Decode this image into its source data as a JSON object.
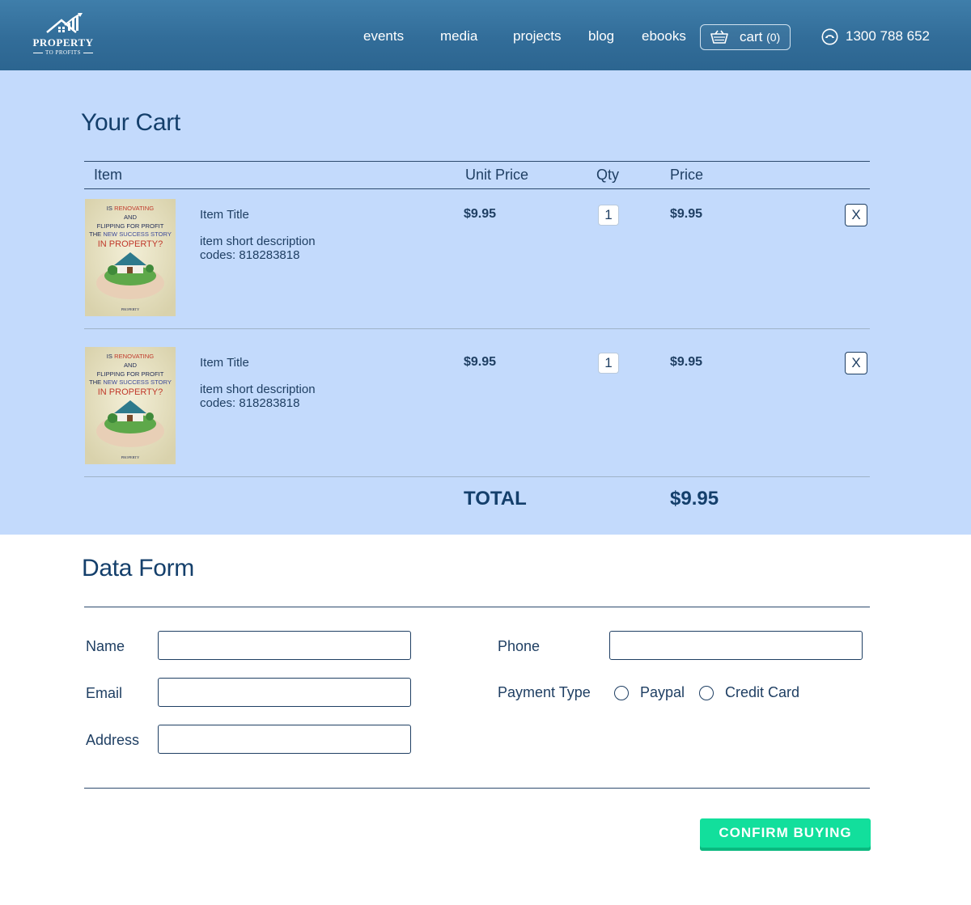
{
  "brand": {
    "name": "PROPERTY",
    "tagline": "TO PROFITS"
  },
  "nav": [
    {
      "label": "events"
    },
    {
      "label": "media"
    },
    {
      "label": "projects"
    },
    {
      "label": "blog"
    },
    {
      "label": "ebooks"
    }
  ],
  "cart_button": {
    "label": "cart",
    "count": "(0)"
  },
  "phone": {
    "number": "1300 788 652"
  },
  "cart": {
    "title": "Your Cart",
    "columns": {
      "item": "Item",
      "unit_price": "Unit Price",
      "qty": "Qty",
      "price": "Price"
    },
    "items": [
      {
        "cover_lines": [
          "IS ",
          "RENOVATING",
          "AND",
          "FLIPPING FOR PROFIT",
          "THE ",
          "NEW SUCCESS STORY",
          "IN PROPERTY?",
          "PROPERTY"
        ],
        "title": "Item Title",
        "description": "item short description",
        "codes": "codes: 818283818",
        "unit_price": "$9.95",
        "qty": "1",
        "price": "$9.95",
        "remove_label": "X"
      },
      {
        "cover_lines": [
          "IS ",
          "RENOVATING",
          "AND",
          "FLIPPING FOR PROFIT",
          "THE ",
          "NEW SUCCESS STORY",
          "IN PROPERTY?",
          "PROPERTY"
        ],
        "title": "Item Title",
        "description": "item short description",
        "codes": "codes: 818283818",
        "unit_price": "$9.95",
        "qty": "1",
        "price": "$9.95",
        "remove_label": "X"
      }
    ],
    "total_label": "TOTAL",
    "total_value": "$9.95"
  },
  "form": {
    "title": "Data Form",
    "name_label": "Name",
    "email_label": "Email",
    "address_label": "Address",
    "phone_label": "Phone",
    "payment_label": "Payment Type",
    "payment_options": [
      "Paypal",
      "Credit Card"
    ],
    "confirm_label": "CONFIRM BUYING"
  },
  "colors": {
    "header": "#326d99",
    "cart_background": "#c3dafc",
    "text": "#1f3f63",
    "accent": "#12df9c"
  },
  "icons": [
    "logo-house-icon",
    "cart-basket-icon",
    "phone-icon"
  ]
}
